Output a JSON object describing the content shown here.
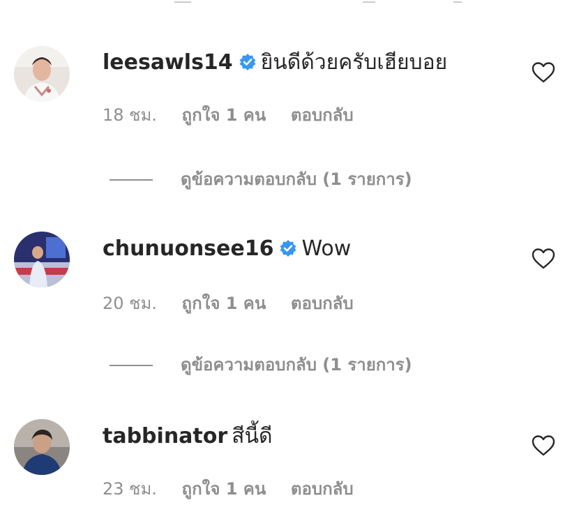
{
  "comments": [
    {
      "username": "leesawls14",
      "verified": true,
      "text": "ยินดีด้วยครับเฮียบอย",
      "time": "18 ชม.",
      "likes": "ถูกใจ 1 คน",
      "reply_label": "ตอบกลับ",
      "view_replies": "ดูข้อความตอบกลับ (1 รายการ)"
    },
    {
      "username": "chunuonsee16",
      "verified": true,
      "text": "Wow",
      "time": "20 ชม.",
      "likes": "ถูกใจ 1 คน",
      "reply_label": "ตอบกลับ",
      "view_replies": "ดูข้อความตอบกลับ (1 รายการ)"
    },
    {
      "username": "tabbinator",
      "verified": false,
      "text": "สีนี้ดี",
      "time": "23 ชม.",
      "likes": "ถูกใจ 1 คน",
      "reply_label": "ตอบกลับ"
    }
  ],
  "icons": {
    "verified": "verified-badge-icon",
    "like": "heart-outline-icon"
  },
  "colors": {
    "text": "#262626",
    "muted": "#8e8e8e",
    "verified": "#3897f0",
    "background": "#ffffff"
  }
}
